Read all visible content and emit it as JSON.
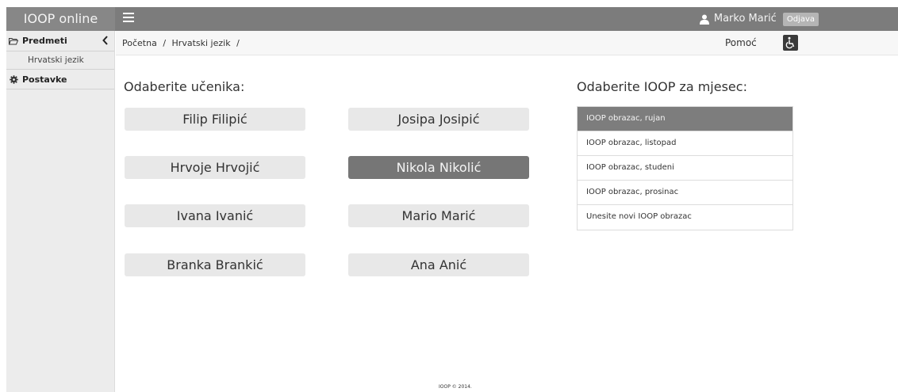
{
  "header": {
    "brand": "IOOP online",
    "user_name": "Marko Marić",
    "logout_label": "Odjava"
  },
  "sidebar": {
    "items": [
      {
        "label": "Predmeti",
        "icon": "folder-open-icon"
      },
      {
        "label": "Hrvatski jezik"
      },
      {
        "label": "Postavke",
        "icon": "gear-icon"
      }
    ]
  },
  "breadcrumb": {
    "items": [
      "Početna",
      "/",
      "Hrvatski jezik",
      "/"
    ]
  },
  "help_label": "Pomoć",
  "students": {
    "heading": "Odaberite učenika:",
    "list": [
      {
        "name": "Filip Filipić",
        "selected": false
      },
      {
        "name": "Josipa Josipić",
        "selected": false
      },
      {
        "name": "Hrvoje Hrvojić",
        "selected": false
      },
      {
        "name": "Nikola Nikolić",
        "selected": true
      },
      {
        "name": "Ivana Ivanić",
        "selected": false
      },
      {
        "name": "Mario Marić",
        "selected": false
      },
      {
        "name": "Branka Brankić",
        "selected": false
      },
      {
        "name": "Ana Anić",
        "selected": false
      }
    ]
  },
  "ioop": {
    "heading": "Odaberite IOOP za mjesec:",
    "items": [
      {
        "label": "IOOP obrazac, rujan",
        "selected": true
      },
      {
        "label": "IOOP obrazac, listopad",
        "selected": false
      },
      {
        "label": "IOOP obrazac, studeni",
        "selected": false
      },
      {
        "label": "IOOP obrazac, prosinac",
        "selected": false
      },
      {
        "label": "Unesite novi IOOP obrazac",
        "selected": false
      }
    ]
  },
  "footer": "IOOP © 2014."
}
